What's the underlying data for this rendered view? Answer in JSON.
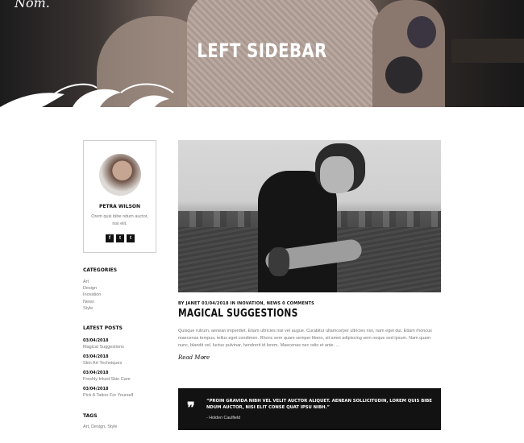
{
  "hero": {
    "logo": "Nom.",
    "title": "LEFT SIDEBAR"
  },
  "author": {
    "name": "PETRA WILSON",
    "bio": "Orem quis bibe ndum auctor, nisi elit.",
    "socials": [
      "f",
      "t",
      "t"
    ]
  },
  "categories": {
    "title": "CATEGORIES",
    "items": [
      "Art",
      "Design",
      "Inovation",
      "News",
      "Style"
    ]
  },
  "latest_posts": {
    "title": "LATEST POSTS",
    "items": [
      {
        "date": "03/04/2018",
        "name": "Magical Suggestions"
      },
      {
        "date": "03/04/2018",
        "name": "Skin Art Techniques"
      },
      {
        "date": "03/04/2018",
        "name": "Freshly Inked Skin Care"
      },
      {
        "date": "03/04/2018",
        "name": "Pick A Tattoo For Yourself"
      }
    ]
  },
  "tags": {
    "title": "TAGS",
    "text": "Art, Design, Style"
  },
  "post": {
    "meta": "BY JANET 03/04/2018 IN INOVATION, NEWS 0 COMMENTS",
    "title": "MAGICAL SUGGESTIONS",
    "excerpt": "Quisque rutrum, aenean imperdiet. Etiam ultricies nisi vel augue. Curabitur ullamcorper ultricies nisi, nam eget dui. Etiam rhoncus maecenas tempus, tellus eget condimen. Rhonc sem quam semper libero, sit amet adipiscing sem neque sed ipsum. Nam quam nunc, blandit vel, luctus pulvinar, hendrerit id lorem. Maecenas nec odio et ante. ...",
    "read_more": "Read More",
    "arrow": "›"
  },
  "quote": {
    "mark": "❞",
    "text": "“PROIN GRAVIDA NIBH VEL VELIT AUCTOR ALIQUET. AENEAN SOLLICITUDIN, LOREM QUIS BIBE NDUM AUCTOR, NISI ELIT CONSE QUAT IPSU NIBH.”",
    "author": "- Holden Caulfield"
  }
}
